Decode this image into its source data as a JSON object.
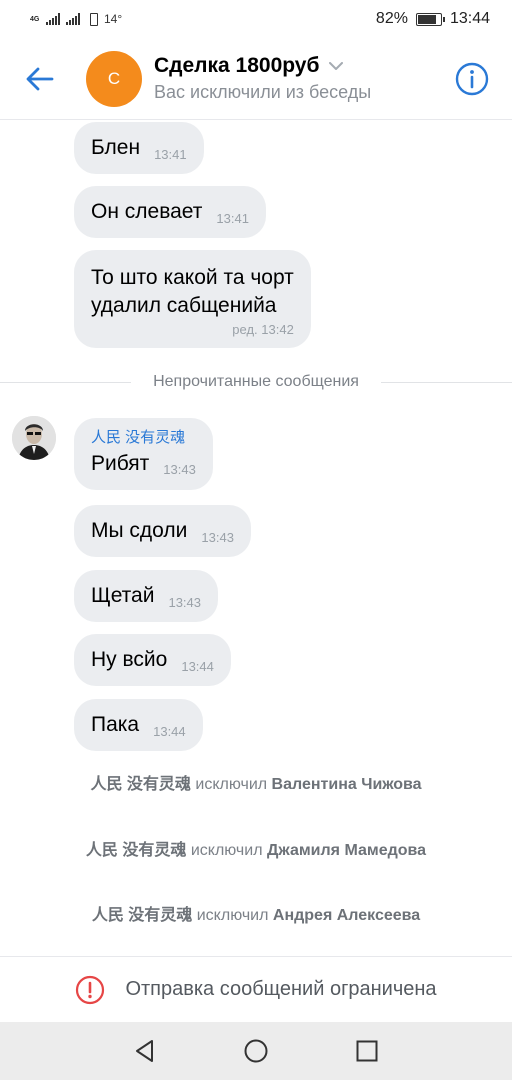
{
  "status_bar": {
    "network": "4G",
    "temperature": "14°",
    "battery": "82%",
    "battery_level": 0.82,
    "time": "13:44"
  },
  "header": {
    "avatar_letter": "С",
    "title": "Сделка 1800руб",
    "subtitle": "Вас исключили из беседы"
  },
  "messages_before": [
    {
      "text": "Блен",
      "time": "13:41"
    },
    {
      "text": "Он слевает",
      "time": "13:41"
    },
    {
      "lines": [
        "То што какой та чорт",
        "удалил сабщенийа"
      ],
      "time": "ред. 13:42"
    }
  ],
  "unread_label": "Непрочитанные сообщения",
  "sender": "人民 没有灵魂",
  "messages_after": [
    {
      "text": "Рибят",
      "time": "13:43"
    },
    {
      "text": "Мы сдоли",
      "time": "13:43"
    },
    {
      "text": "Щетай",
      "time": "13:43"
    },
    {
      "text": "Ну всйо",
      "time": "13:44"
    },
    {
      "text": "Пака",
      "time": "13:44"
    }
  ],
  "system_messages": [
    {
      "actor": "人民 没有灵魂",
      "action": "исключил",
      "target": "Валентина Чижова"
    },
    {
      "actor": "人民 没有灵魂",
      "action": "исключил",
      "target": "Джамиля Мамедова"
    },
    {
      "actor": "人民 没有灵魂",
      "action": "исключил",
      "target": "Андрея Алексеева"
    }
  ],
  "restriction": {
    "text": "Отправка сообщений ограничена"
  },
  "colors": {
    "accent": "#2a79d6",
    "avatar": "#f48b1c",
    "bubble": "#ebedf0",
    "warning": "#e64646"
  }
}
